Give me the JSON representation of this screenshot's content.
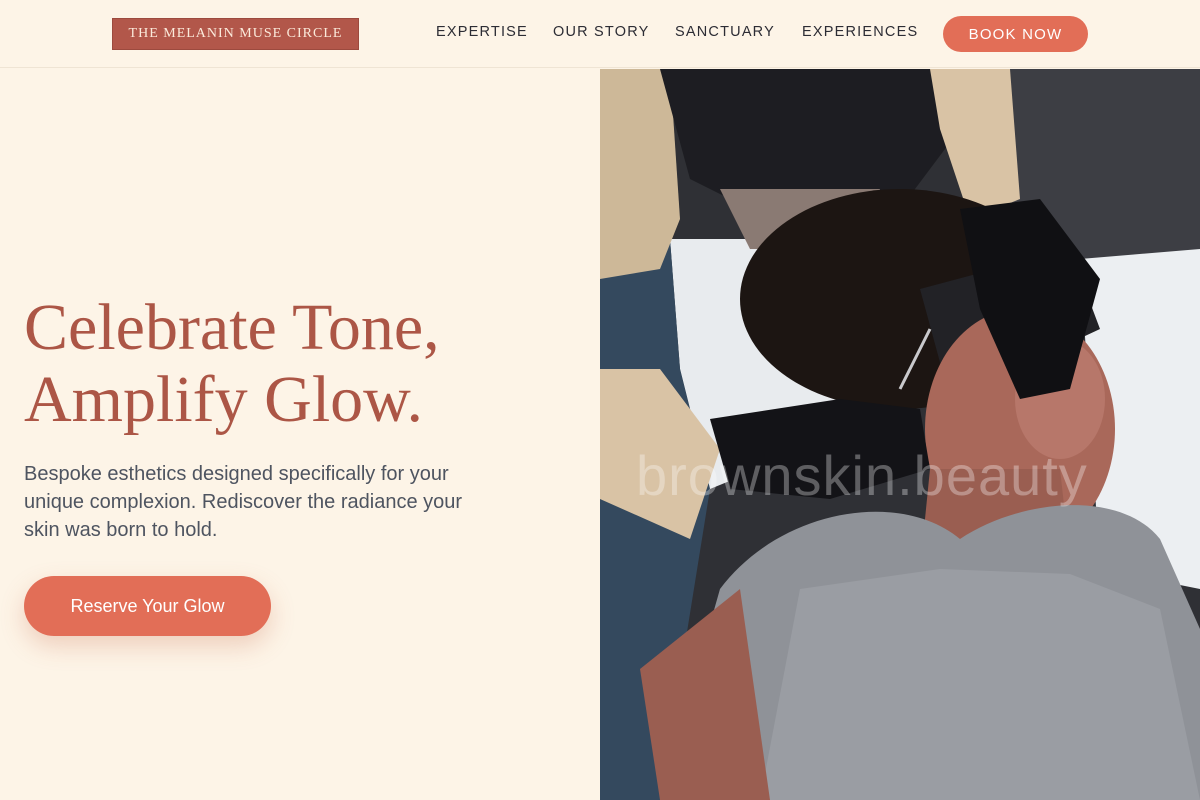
{
  "header": {
    "logo": "THE MELANIN MUSE CIRCLE",
    "nav": [
      "EXPERTISE",
      "OUR STORY",
      "SANCTUARY",
      "EXPERIENCES"
    ],
    "cta": "BOOK NOW"
  },
  "hero": {
    "title_line1": "Celebrate Tone,",
    "title_line2": "Amplify Glow.",
    "subtitle": "Bespoke esthetics designed specifically for your unique complexion. Rediscover the radiance your skin was born to hold.",
    "cta": "Reserve Your Glow"
  },
  "photo": {
    "watermark": "brownskin.beauty",
    "description_icon": "facial-treatment-photo"
  },
  "colors": {
    "background": "#fdf4e7",
    "accent": "#e26e57",
    "logo_bg": "#b2574a",
    "title": "#ac5646"
  }
}
